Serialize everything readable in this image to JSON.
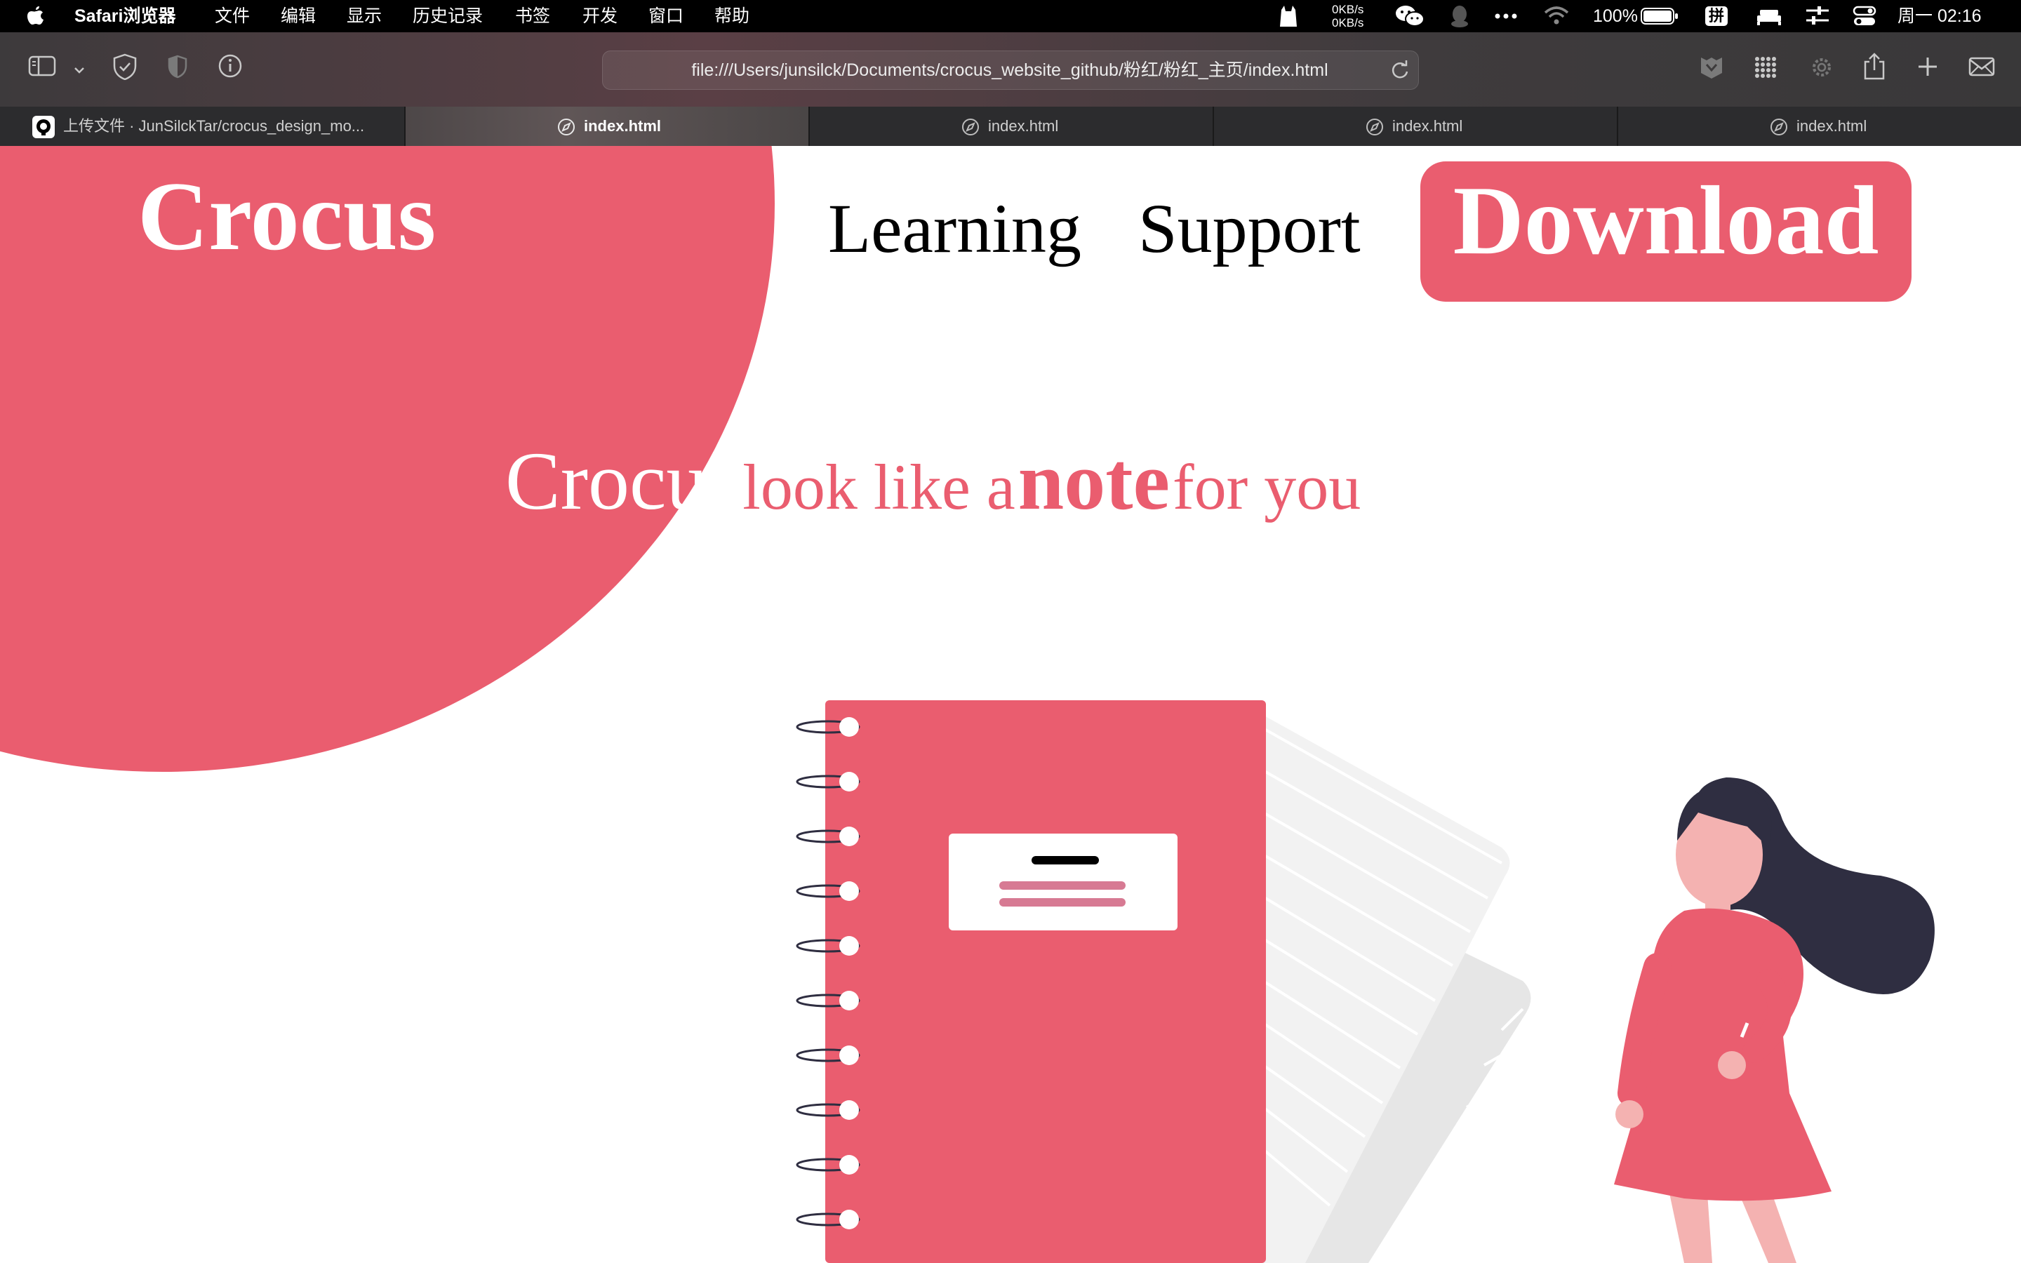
{
  "menubar": {
    "app": "Safari浏览器",
    "menus": [
      "文件",
      "编辑",
      "显示",
      "历史记录",
      "书签",
      "开发",
      "窗口",
      "帮助"
    ],
    "net_up": "0KB/s",
    "net_down": "0KB/s",
    "battery": "100%",
    "input_method": "拼",
    "clock": "周一 02:16"
  },
  "toolbar": {
    "url": "file:///Users/junsilck/Documents/crocus_website_github/粉红/粉红_主页/index.html"
  },
  "tabs": [
    {
      "label": "上传文件 · JunSilckTar/crocus_design_mo...",
      "icon": "github-icon"
    },
    {
      "label": "index.html",
      "icon": "compass-icon"
    },
    {
      "label": "index.html",
      "icon": "compass-icon"
    },
    {
      "label": "index.html",
      "icon": "compass-icon"
    },
    {
      "label": "index.html",
      "icon": "compass-icon"
    }
  ],
  "page": {
    "logo": "Crocus",
    "nav": {
      "learning": "Learning",
      "support": "Support",
      "download": "Download"
    },
    "headline": {
      "crocus": "Crocus",
      "part1": "look like a",
      "note": "note",
      "part2": "for you"
    }
  },
  "colors": {
    "accent": "#ea5d6f",
    "character_dark": "#2f2e41",
    "skin": "#f4b2b1",
    "paper": "#f2f2f2"
  }
}
